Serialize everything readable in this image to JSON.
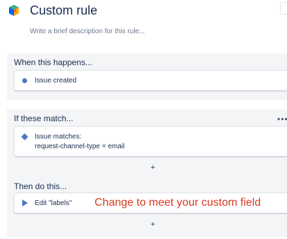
{
  "header": {
    "logo_icon": "automation-cube-icon",
    "title": "Custom rule",
    "description_placeholder": "Write a brief description for this rule..."
  },
  "trigger_section": {
    "label": "When this happens...",
    "card": {
      "icon": "dot-icon",
      "text": "Issue created"
    }
  },
  "condition_section": {
    "label": "If these match...",
    "more_label": "•••",
    "card": {
      "icon": "diamond-icon",
      "line1": "Issue matches:",
      "line2": "request-channel-type = email"
    },
    "add_label": "+"
  },
  "action_section": {
    "label": "Then do this...",
    "card": {
      "icon": "play-icon",
      "text": "Edit \"labels\""
    },
    "annotation": "Change to meet your custom field",
    "add_label": "+"
  },
  "colors": {
    "accent": "#4a78c4",
    "annotation": "#d9381e",
    "band": "#f4f5f7",
    "text": "#172b4d"
  }
}
